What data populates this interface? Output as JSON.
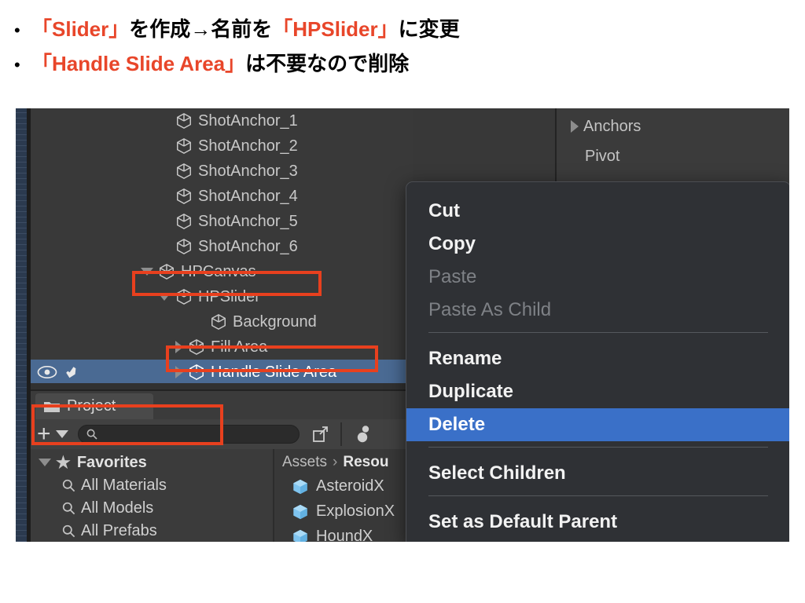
{
  "slide": {
    "bullets": [
      {
        "marker": "•",
        "segments": [
          {
            "text": "「Slider」",
            "style": "red"
          },
          {
            "text": "を作成→名前を",
            "style": "black"
          },
          {
            "text": "「HPSlider」",
            "style": "red"
          },
          {
            "text": "に変更",
            "style": "black"
          }
        ]
      },
      {
        "marker": "•",
        "segments": [
          {
            "text": "「Handle Slide Area」",
            "style": "red"
          },
          {
            "text": "は不要なので削除",
            "style": "black"
          }
        ]
      }
    ],
    "accent_color": "#e8462a",
    "text_color": "#000000"
  },
  "editor": {
    "hierarchy": {
      "rows": [
        {
          "label": "ShotAnchor_1",
          "depth": 3,
          "toggle": "none",
          "selected": false
        },
        {
          "label": "ShotAnchor_2",
          "depth": 3,
          "toggle": "none",
          "selected": false
        },
        {
          "label": "ShotAnchor_3",
          "depth": 3,
          "toggle": "none",
          "selected": false
        },
        {
          "label": "ShotAnchor_4",
          "depth": 3,
          "toggle": "none",
          "selected": false
        },
        {
          "label": "ShotAnchor_5",
          "depth": 3,
          "toggle": "none",
          "selected": false
        },
        {
          "label": "ShotAnchor_6",
          "depth": 3,
          "toggle": "none",
          "selected": false
        },
        {
          "label": "HPCanvas",
          "depth": 2,
          "toggle": "expanded",
          "selected": false
        },
        {
          "label": "HPSlider",
          "depth": 3,
          "toggle": "expanded",
          "selected": false
        },
        {
          "label": "Background",
          "depth": 4,
          "toggle": "none",
          "selected": false
        },
        {
          "label": "Fill Area",
          "depth": 4,
          "toggle": "collapsed",
          "selected": false
        },
        {
          "label": "Handle Slide Area",
          "depth": 4,
          "toggle": "collapsed",
          "selected": true
        }
      ],
      "selected_row_icons": [
        "eye-icon",
        "hand-icon"
      ],
      "selection_color": "#4a6a93"
    },
    "inspector": {
      "rows": [
        {
          "label": "Anchors",
          "toggle": "collapsed"
        },
        {
          "label": "Pivot",
          "toggle": "none"
        }
      ]
    },
    "context_menu": {
      "items": [
        {
          "label": "Cut",
          "state": "normal"
        },
        {
          "label": "Copy",
          "state": "normal"
        },
        {
          "label": "Paste",
          "state": "disabled"
        },
        {
          "label": "Paste As Child",
          "state": "disabled"
        },
        {
          "label": "Rename",
          "state": "normal"
        },
        {
          "label": "Duplicate",
          "state": "normal"
        },
        {
          "label": "Delete",
          "state": "highlighted"
        },
        {
          "label": "Select Children",
          "state": "normal"
        },
        {
          "label": "Set as Default Parent",
          "state": "normal"
        }
      ],
      "highlight_color": "#3a70c8",
      "background_color": "#2f3135"
    },
    "project_panel": {
      "tab_label": "Project",
      "search_value": "",
      "search_placeholder": "",
      "favorites": {
        "header": "Favorites",
        "items": [
          "All Materials",
          "All Models",
          "All Prefabs"
        ]
      },
      "breadcrumb": [
        "Assets",
        "Resou"
      ],
      "assets": [
        "AsteroidX",
        "ExplosionX",
        "HoundX"
      ]
    },
    "annotations": {
      "color": "#e8401e",
      "boxes": [
        "hpslider-row",
        "handle-slide-area-row",
        "delete-menu-item"
      ]
    }
  }
}
